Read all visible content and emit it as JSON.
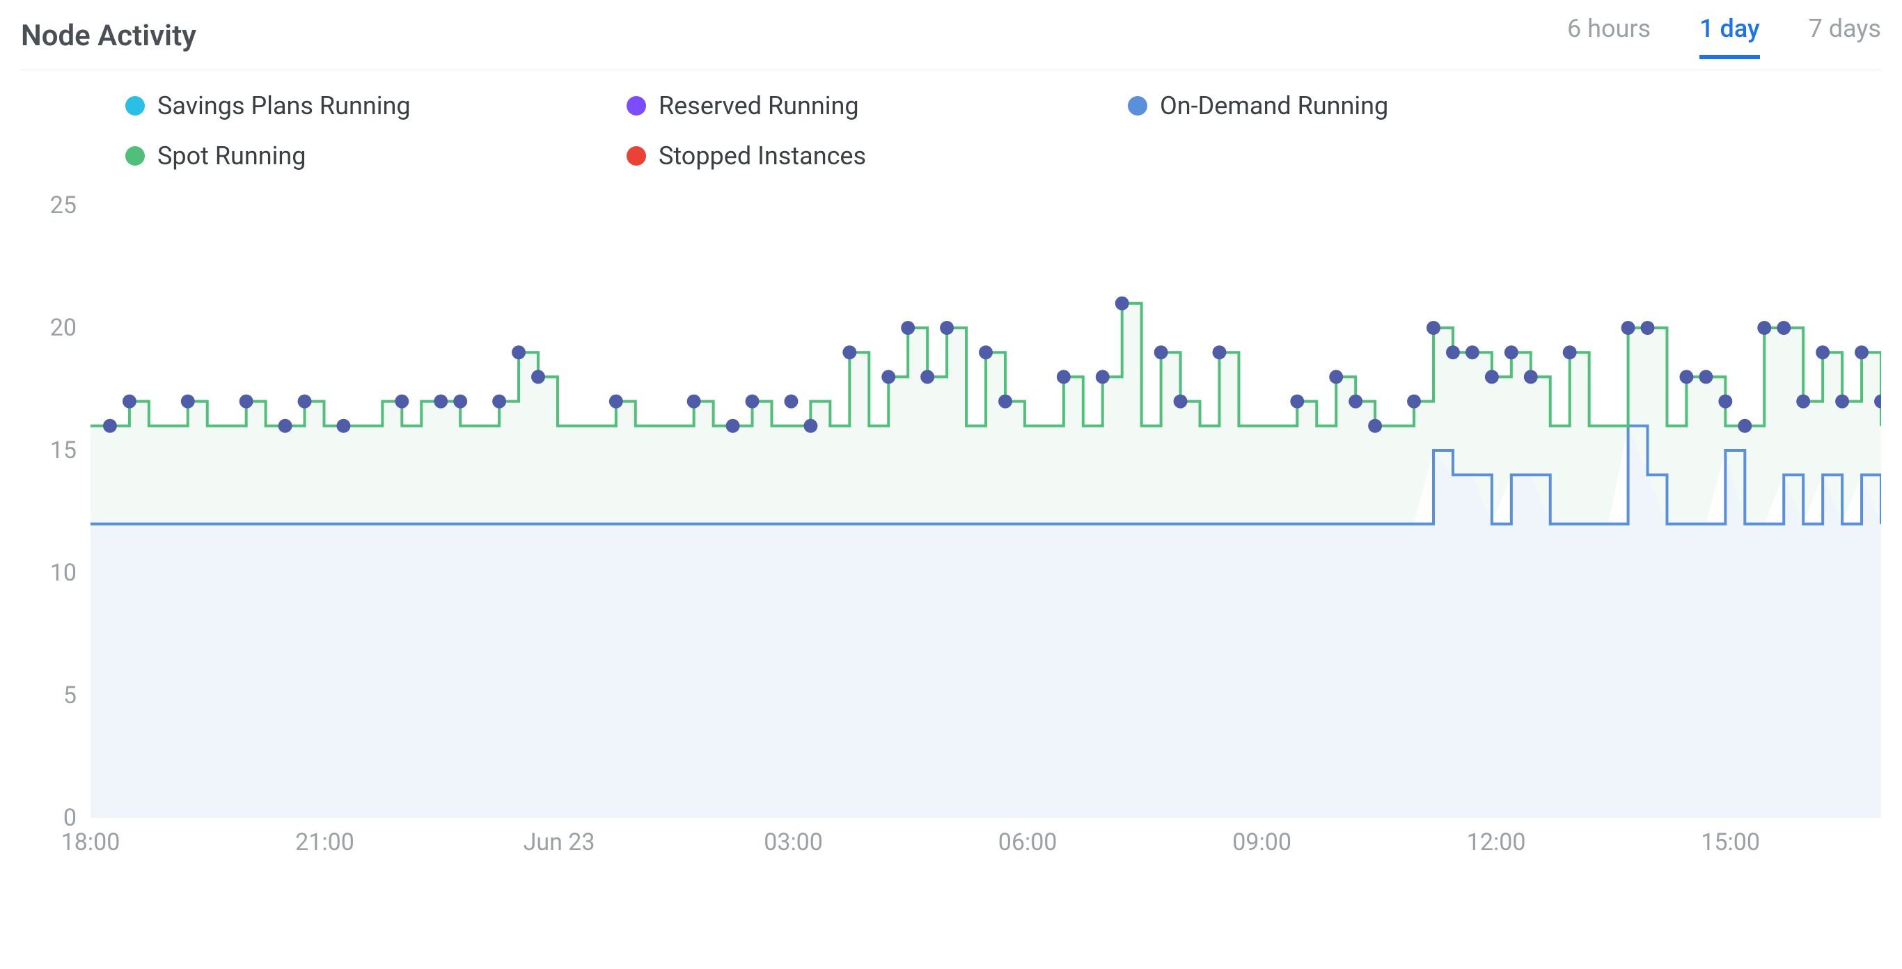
{
  "title": "Node Activity",
  "range_tabs": [
    {
      "label": "6 hours",
      "active": false
    },
    {
      "label": "1 day",
      "active": true
    },
    {
      "label": "7 days",
      "active": false
    }
  ],
  "legend": [
    {
      "name": "Savings Plans Running",
      "color": "#29c0e7"
    },
    {
      "name": "Reserved Running",
      "color": "#7c4dff"
    },
    {
      "name": "On-Demand Running",
      "color": "#5a8fdc"
    },
    {
      "name": "Spot Running",
      "color": "#4fc07a"
    },
    {
      "name": "Stopped Instances",
      "color": "#ea4335"
    }
  ],
  "chart_data": {
    "type": "line",
    "title": "Node Activity",
    "xlabel": "",
    "ylabel": "",
    "ylim": [
      0,
      25
    ],
    "x_ticks": [
      "18:00",
      "21:00",
      "Jun 23",
      "03:00",
      "06:00",
      "09:00",
      "12:00",
      "15:00"
    ],
    "y_ticks": [
      0,
      5,
      10,
      15,
      20,
      25
    ],
    "x_values": [
      "18:00",
      "18:15",
      "18:30",
      "18:45",
      "19:00",
      "19:15",
      "19:30",
      "19:45",
      "20:00",
      "20:15",
      "20:30",
      "20:45",
      "21:00",
      "21:15",
      "21:30",
      "21:45",
      "22:00",
      "22:15",
      "22:30",
      "22:45",
      "23:00",
      "23:15",
      "23:30",
      "23:45",
      "00:00",
      "00:15",
      "00:30",
      "00:45",
      "01:00",
      "01:15",
      "01:30",
      "01:45",
      "02:00",
      "02:15",
      "02:30",
      "02:45",
      "03:00",
      "03:15",
      "03:30",
      "03:45",
      "04:00",
      "04:15",
      "04:30",
      "04:45",
      "05:00",
      "05:15",
      "05:30",
      "05:45",
      "06:00",
      "06:15",
      "06:30",
      "06:45",
      "07:00",
      "07:15",
      "07:30",
      "07:45",
      "08:00",
      "08:15",
      "08:30",
      "08:45",
      "09:00",
      "09:15",
      "09:30",
      "09:45",
      "10:00",
      "10:15",
      "10:30",
      "10:45",
      "11:00",
      "11:15",
      "11:30",
      "11:45",
      "12:00",
      "12:15",
      "12:30",
      "12:45",
      "13:00",
      "13:15",
      "13:30",
      "13:45",
      "14:00",
      "14:15",
      "14:30",
      "14:45",
      "15:00",
      "15:15",
      "15:30",
      "15:45",
      "16:00",
      "16:15",
      "16:30",
      "16:45",
      "17:00"
    ],
    "series": [
      {
        "name": "On-Demand Running",
        "color": "#5a8fdc",
        "fill": "#f0f4fb",
        "values": [
          12,
          12,
          12,
          12,
          12,
          12,
          12,
          12,
          12,
          12,
          12,
          12,
          12,
          12,
          12,
          12,
          12,
          12,
          12,
          12,
          12,
          12,
          12,
          12,
          12,
          12,
          12,
          12,
          12,
          12,
          12,
          12,
          12,
          12,
          12,
          12,
          12,
          12,
          12,
          12,
          12,
          12,
          12,
          12,
          12,
          12,
          12,
          12,
          12,
          12,
          12,
          12,
          12,
          12,
          12,
          12,
          12,
          12,
          12,
          12,
          12,
          12,
          12,
          12,
          12,
          12,
          12,
          12,
          12,
          15,
          14,
          14,
          12,
          14,
          14,
          12,
          12,
          12,
          12,
          16,
          14,
          12,
          12,
          12,
          15,
          12,
          12,
          14,
          12,
          14,
          12,
          14,
          12
        ]
      },
      {
        "name": "Spot Running",
        "color": "#4fc07a",
        "fill": "#f3faf5",
        "values": [
          16,
          16,
          17,
          16,
          16,
          17,
          16,
          16,
          17,
          16,
          16,
          17,
          16,
          16,
          16,
          17,
          16,
          17,
          17,
          16,
          16,
          17,
          19,
          18,
          16,
          16,
          16,
          17,
          16,
          16,
          16,
          17,
          16,
          16,
          17,
          16,
          16,
          17,
          16,
          19,
          16,
          18,
          20,
          18,
          20,
          16,
          19,
          17,
          16,
          16,
          18,
          16,
          18,
          21,
          16,
          19,
          17,
          16,
          19,
          16,
          16,
          16,
          17,
          16,
          18,
          17,
          16,
          16,
          17,
          20,
          19,
          19,
          18,
          19,
          18,
          16,
          19,
          16,
          16,
          20,
          20,
          16,
          18,
          18,
          16,
          16,
          20,
          20,
          17,
          19,
          17,
          19,
          16
        ]
      }
    ],
    "markers": {
      "color": "#4f5ca8",
      "points_index_value": [
        [
          1,
          16
        ],
        [
          2,
          17
        ],
        [
          5,
          17
        ],
        [
          8,
          17
        ],
        [
          10,
          16
        ],
        [
          11,
          17
        ],
        [
          13,
          16
        ],
        [
          16,
          17
        ],
        [
          18,
          17
        ],
        [
          19,
          17
        ],
        [
          21,
          17
        ],
        [
          22,
          19
        ],
        [
          23,
          18
        ],
        [
          27,
          17
        ],
        [
          31,
          17
        ],
        [
          33,
          16
        ],
        [
          34,
          17
        ],
        [
          36,
          17
        ],
        [
          37,
          16
        ],
        [
          39,
          19
        ],
        [
          41,
          18
        ],
        [
          42,
          20
        ],
        [
          43,
          18
        ],
        [
          44,
          20
        ],
        [
          46,
          19
        ],
        [
          47,
          17
        ],
        [
          50,
          18
        ],
        [
          52,
          18
        ],
        [
          53,
          21
        ],
        [
          55,
          19
        ],
        [
          56,
          17
        ],
        [
          58,
          19
        ],
        [
          62,
          17
        ],
        [
          64,
          18
        ],
        [
          65,
          17
        ],
        [
          66,
          16
        ],
        [
          68,
          17
        ],
        [
          69,
          20
        ],
        [
          70,
          19
        ],
        [
          71,
          19
        ],
        [
          72,
          18
        ],
        [
          73,
          19
        ],
        [
          74,
          18
        ],
        [
          76,
          19
        ],
        [
          79,
          20
        ],
        [
          80,
          20
        ],
        [
          82,
          18
        ],
        [
          83,
          18
        ],
        [
          84,
          17
        ],
        [
          85,
          16
        ],
        [
          86,
          20
        ],
        [
          87,
          20
        ],
        [
          88,
          17
        ],
        [
          89,
          19
        ],
        [
          90,
          17
        ],
        [
          91,
          19
        ],
        [
          92,
          17
        ]
      ]
    }
  }
}
